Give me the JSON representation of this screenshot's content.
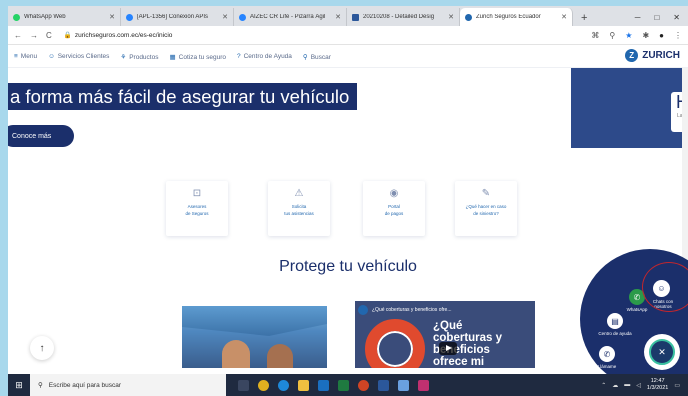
{
  "browser": {
    "tabs": [
      {
        "title": "WhatsApp Web",
        "color": "#25d366",
        "active": false
      },
      {
        "title": "[APL-1356] Conexión APIs",
        "color": "#2684ff",
        "active": false
      },
      {
        "title": "AIZEC CR Life - Pizarra Ágil",
        "color": "#2684ff",
        "active": false
      },
      {
        "title": "20210208 - Detailed Desig",
        "color": "#2b579a",
        "active": false
      },
      {
        "title": "Zurich Seguros Ecuador",
        "color": "#2167ae",
        "active": true
      }
    ],
    "new_tab": "+",
    "url": "zurichseguros.com.ec/es-ec/inicio"
  },
  "site_nav": {
    "items": [
      {
        "icon": "≡",
        "label": "Menu"
      },
      {
        "icon": "☺",
        "label": "Servicios Clientes"
      },
      {
        "icon": "⚘",
        "label": "Productos"
      },
      {
        "icon": "▦",
        "label": "Cotiza tu seguro"
      },
      {
        "icon": "?",
        "label": "Centro de Ayuda"
      },
      {
        "icon": "⚲",
        "label": "Buscar"
      }
    ],
    "brand": "ZURICH"
  },
  "hero": {
    "title": "a forma más fácil de asegurar tu vehículo",
    "button": "Conoce más",
    "right_heading": "H",
    "right_sub": "La"
  },
  "cards": [
    {
      "icon": "⊡",
      "line1": "Asesores",
      "line2": "de Seguros"
    },
    {
      "icon": "⚠",
      "line1": "Solicita",
      "line2": "tus asistencias"
    },
    {
      "icon": "◉",
      "line1": "Portal",
      "line2": "de pagos"
    },
    {
      "icon": "✎",
      "line1": "¿Qué hacer en caso",
      "line2": "de siniestro?"
    }
  ],
  "section_title": "Protege tu vehículo",
  "video": {
    "bar_text": "¿Qué coberturas y beneficios ofre...",
    "overlay_text": "¿Qué coberturas y beneficios ofrece mi"
  },
  "chat_widget": {
    "whatsapp": "WhatsApp",
    "chats": "Chats con nosotros",
    "help": "Centro de ayuda",
    "call": "Llámame"
  },
  "taskbar": {
    "search_placeholder": "Escribe aquí para buscar",
    "time": "12:47",
    "date": "1/3/2021"
  }
}
